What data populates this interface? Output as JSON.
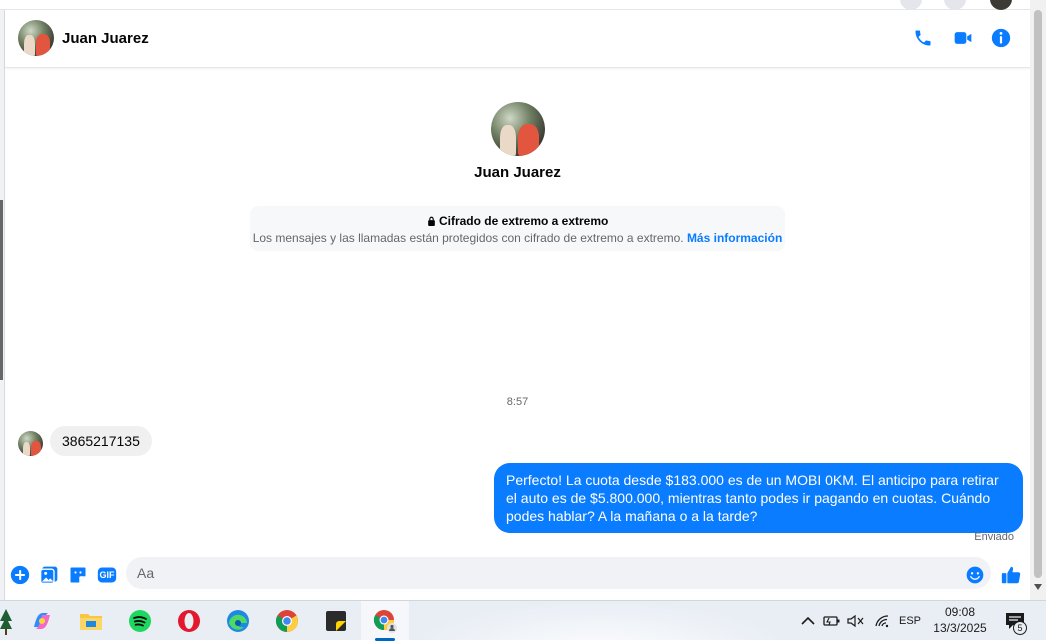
{
  "conversation": {
    "contact_name": "Juan Juarez",
    "header_actions": [
      "phone-icon",
      "video-camera-icon",
      "info-icon"
    ]
  },
  "encryption_notice": {
    "title": "Cifrado de extremo a extremo",
    "description": "Los mensajes y las llamadas están protegidos con cifrado de extremo a extremo.",
    "link": "Más información"
  },
  "messages": {
    "timestamp": "8:57",
    "incoming": [
      {
        "text": "3865217135"
      }
    ],
    "outgoing": [
      {
        "text": "Perfecto! La cuota desde $183.000 es de un MOBI 0KM. El anticipo para retirar el auto es de $5.800.000, mientras tanto podes ir pagando en cuotas. Cuándo podes hablar? A la mañana o a la tarde?"
      }
    ],
    "status": "Enviado"
  },
  "composer": {
    "placeholder": "Aa",
    "left_actions": [
      "plus-icon",
      "image-icon",
      "sticker-icon",
      "gif-icon"
    ],
    "gif_label": "GIF",
    "right_actions": [
      "emoji-icon",
      "like-icon"
    ]
  },
  "taskbar": {
    "apps": [
      "copilot-icon",
      "file-explorer-icon",
      "spotify-icon",
      "opera-icon",
      "edge-icon",
      "chrome-icon",
      "sticky-notes-icon",
      "chrome-profile-icon"
    ],
    "language": "ESP",
    "time": "09:08",
    "date": "13/3/2025",
    "notifications": "5"
  },
  "colors": {
    "accent": "#0a7cff",
    "bubble_in": "#f0f0f0",
    "text_primary": "#050505",
    "text_secondary": "#65676b"
  }
}
